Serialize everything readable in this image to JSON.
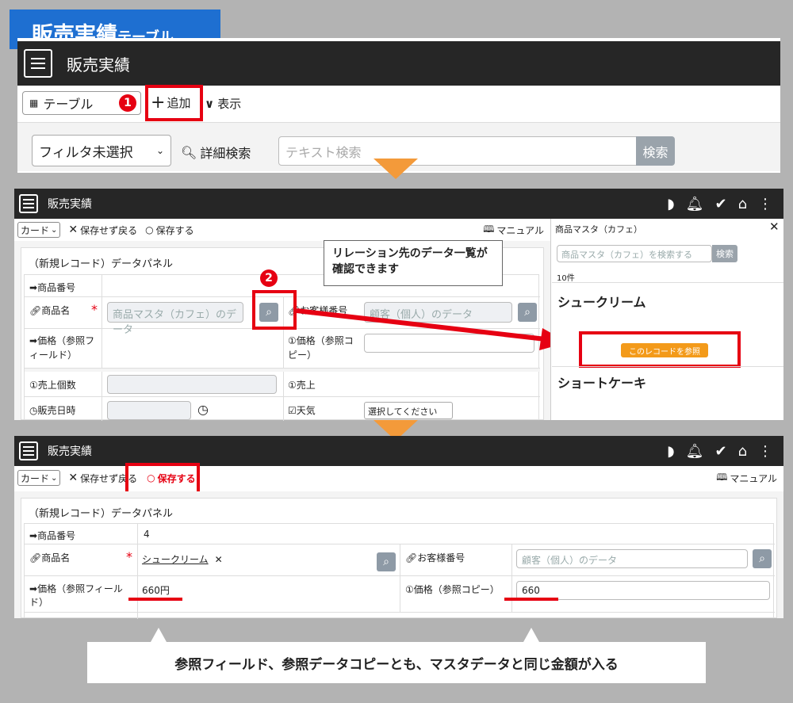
{
  "header": {
    "title_main": "販売実績",
    "title_sub": "テーブル"
  },
  "screen1": {
    "app_title": "販売実績",
    "table_label": "テーブル",
    "step1": "1",
    "add_label": "追加",
    "view_label": "表示",
    "filter_select": "フィルタ未選択",
    "detail_search": "詳細検索",
    "text_search_placeholder": "テキスト検索",
    "search_button": "検索"
  },
  "screen2": {
    "app_title": "販売実績",
    "card_select": "カード",
    "discard_back": "保存せず戻る",
    "save": "保存する",
    "manual": "マニュアル",
    "panel_title": "（新規レコード）データパネル",
    "rows": {
      "product_no": "商品番号",
      "product_name": "商品名",
      "product_placeholder": "商品マスタ（カフェ）のデータ",
      "customer_no": "お客様番号",
      "customer_placeholder": "顧客（個人）のデータ",
      "price_ref_field": "価格（参照フィールド）",
      "price_ref_copy": "価格（参照コピー）",
      "qty": "売上個数",
      "sales": "売上",
      "datetime": "販売日時",
      "weather": "天気",
      "weather_select": "選択してください"
    },
    "step2": "2",
    "callout": "リレーション先のデータ一覧が確認できます",
    "side": {
      "title": "商品マスタ（カフェ）",
      "search_placeholder": "商品マスタ（カフェ）を検索する",
      "search_button": "検索",
      "count": "10件",
      "item1": "シュークリーム",
      "ref_button": "このレコードを参照",
      "item2": "ショートケーキ"
    }
  },
  "screen3": {
    "app_title": "販売実績",
    "card_select": "カード",
    "discard_back": "保存せず戻る",
    "save": "保存する",
    "manual": "マニュアル",
    "panel_title": "（新規レコード）データパネル",
    "product_no_label": "商品番号",
    "product_no_value": "4",
    "product_name_label": "商品名",
    "product_name_value": "シュークリーム",
    "customer_label": "お客様番号",
    "customer_placeholder": "顧客（個人）のデータ",
    "price_ref_field_label": "価格（参照フィールド）",
    "price_ref_field_value": "660円",
    "price_ref_copy_label": "価格（参照コピー）",
    "price_ref_copy_value": "660"
  },
  "caption": "参照フィールド、参照データコピーとも、マスタデータと同じ金額が入る",
  "colors": {
    "accent_blue": "#1e6fd1",
    "highlight_red": "#e60012",
    "arrow_orange": "#f39a3a",
    "dark_bar": "#262626"
  }
}
